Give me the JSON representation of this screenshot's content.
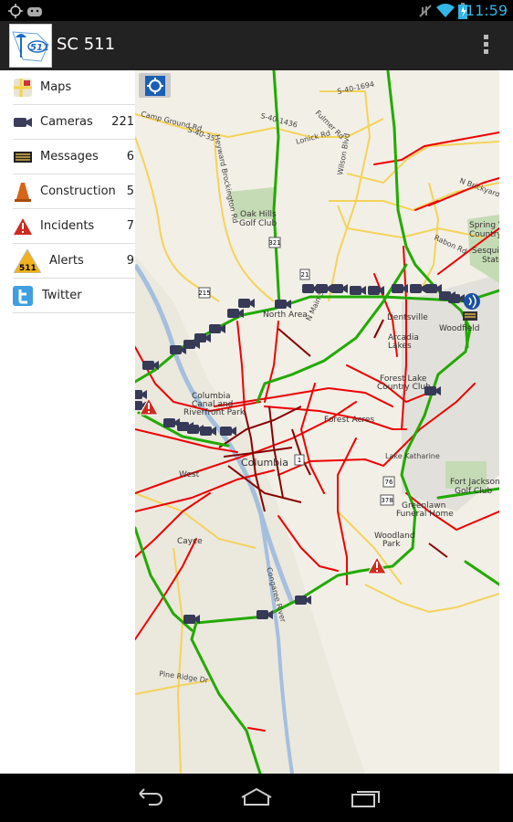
{
  "status_bar": {
    "time": "11:59",
    "icons": [
      "gps-icon",
      "android-icon",
      "mute-icon",
      "wifi-icon",
      "battery-charging-icon"
    ]
  },
  "app": {
    "title": "SC 511",
    "logo_text": "511"
  },
  "sidebar": {
    "items": [
      {
        "label": "Maps",
        "count": "",
        "icon": "maps-icon"
      },
      {
        "label": "Cameras",
        "count": "221",
        "icon": "camera-icon"
      },
      {
        "label": "Messages",
        "count": "6",
        "icon": "message-sign-icon"
      },
      {
        "label": "Construction",
        "count": "5",
        "icon": "traffic-cone-icon"
      },
      {
        "label": "Incidents",
        "count": "7",
        "icon": "warning-icon"
      },
      {
        "label": "Alerts",
        "count": "9",
        "icon": "alert-511-icon",
        "badge": "511"
      },
      {
        "label": "Twitter",
        "count": "",
        "icon": "twitter-icon"
      }
    ]
  },
  "map": {
    "colors": {
      "free_flow": "#22aa00",
      "moderate": "#ffcc00",
      "heavy": "#ee0000",
      "stopped": "#880000",
      "land": "#f2efe6",
      "water": "#a5bfdd",
      "park": "#c5dbb5"
    },
    "labels": {
      "camp_ground": "Camp Ground Rd",
      "s40_35": "S-40-35",
      "s40_1436": "S-40-1436",
      "s40_1694": "S-40-1694",
      "fulmer": "Fulmer Rd",
      "lonick": "Lonick Rd",
      "wilson": "Wilson Blvd",
      "heyward": "Heyward Brockington Rd",
      "oak_hills": "Oak Hills",
      "golf_club": "Golf Club",
      "n_brickyard": "N Brickyard Rd",
      "rabon": "Rabon Rd",
      "spring_valley": "Spring Valley",
      "country_club_sv": "Country Club",
      "sesqui": "Sesquicentennial",
      "state": "State",
      "north_area": "North Area",
      "n_main": "N Main St",
      "dentsville": "Dentsville",
      "woodfield": "Woodfield",
      "arcadia": "Arcadia",
      "lakes": "Lakes",
      "forest_lake": "Forest Lake",
      "country_club_fl": "Country Club",
      "columbia_riv": "Columbia",
      "canal": "Canal and",
      "riverfront": "Riverfront Park",
      "forest_acres": "Forest Acres",
      "columbia": "Columbia",
      "west": "West",
      "columbia_w": "Columbia",
      "lake_katharine": "Lake Katharine",
      "fort_jackson": "Fort Jackson",
      "golf_club_fj": "Golf Club",
      "greenlawn": "Greenlawn",
      "funeral": "Funeral Home",
      "woodland": "Woodland",
      "park": "Park",
      "cayce": "Cayce",
      "congaree": "Congaree River",
      "pine_ridge": "Pine Ridge Dr",
      "shield_21": "21",
      "shield_321": "321",
      "shield_215": "215",
      "shield_1": "1",
      "shield_76": "76",
      "shield_378": "378"
    }
  },
  "navbar": {
    "buttons": [
      "back",
      "home",
      "recent-apps"
    ]
  }
}
